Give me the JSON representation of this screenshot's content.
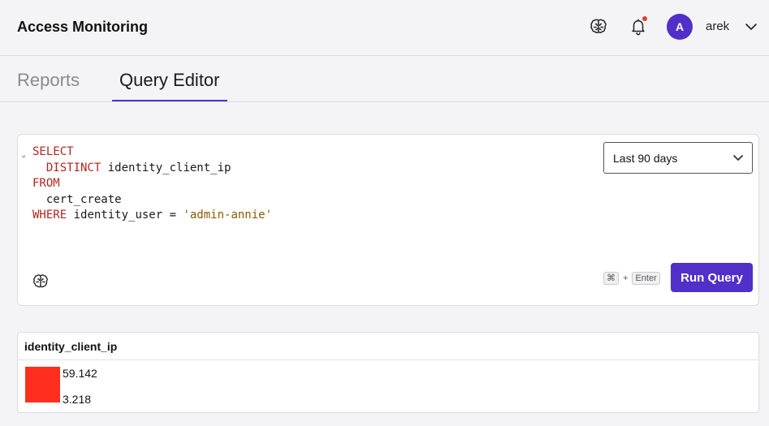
{
  "header": {
    "title": "Access Monitoring",
    "icons": [
      "brain-icon",
      "bell-icon"
    ],
    "has_notification": true,
    "user": {
      "initial": "A",
      "name": "arek"
    }
  },
  "tabs": [
    {
      "label": "Reports",
      "active": false
    },
    {
      "label": "Query Editor",
      "active": true
    }
  ],
  "editor": {
    "code": {
      "line1_kw": "SELECT",
      "line2_kw": "DISTINCT",
      "line2_rest": " identity_client_ip",
      "line3_kw": "FROM",
      "line4_rest": "cert_create",
      "line5_kw": "WHERE",
      "line5_rest": " identity_user = ",
      "line5_str": "'admin-annie'"
    },
    "time_range": {
      "selected": "Last 90 days"
    },
    "shortcut": {
      "key1": "⌘",
      "plus": "+",
      "key2": "Enter"
    },
    "run_label": "Run Query"
  },
  "results": {
    "columns": [
      "identity_client_ip"
    ],
    "rows": [
      "59.142",
      "3.218"
    ]
  },
  "colors": {
    "accent": "#512fc9",
    "keyword": "#b3261e",
    "string": "#8a5a00",
    "redaction": "#ff2e1f",
    "notification": "#e53935"
  }
}
